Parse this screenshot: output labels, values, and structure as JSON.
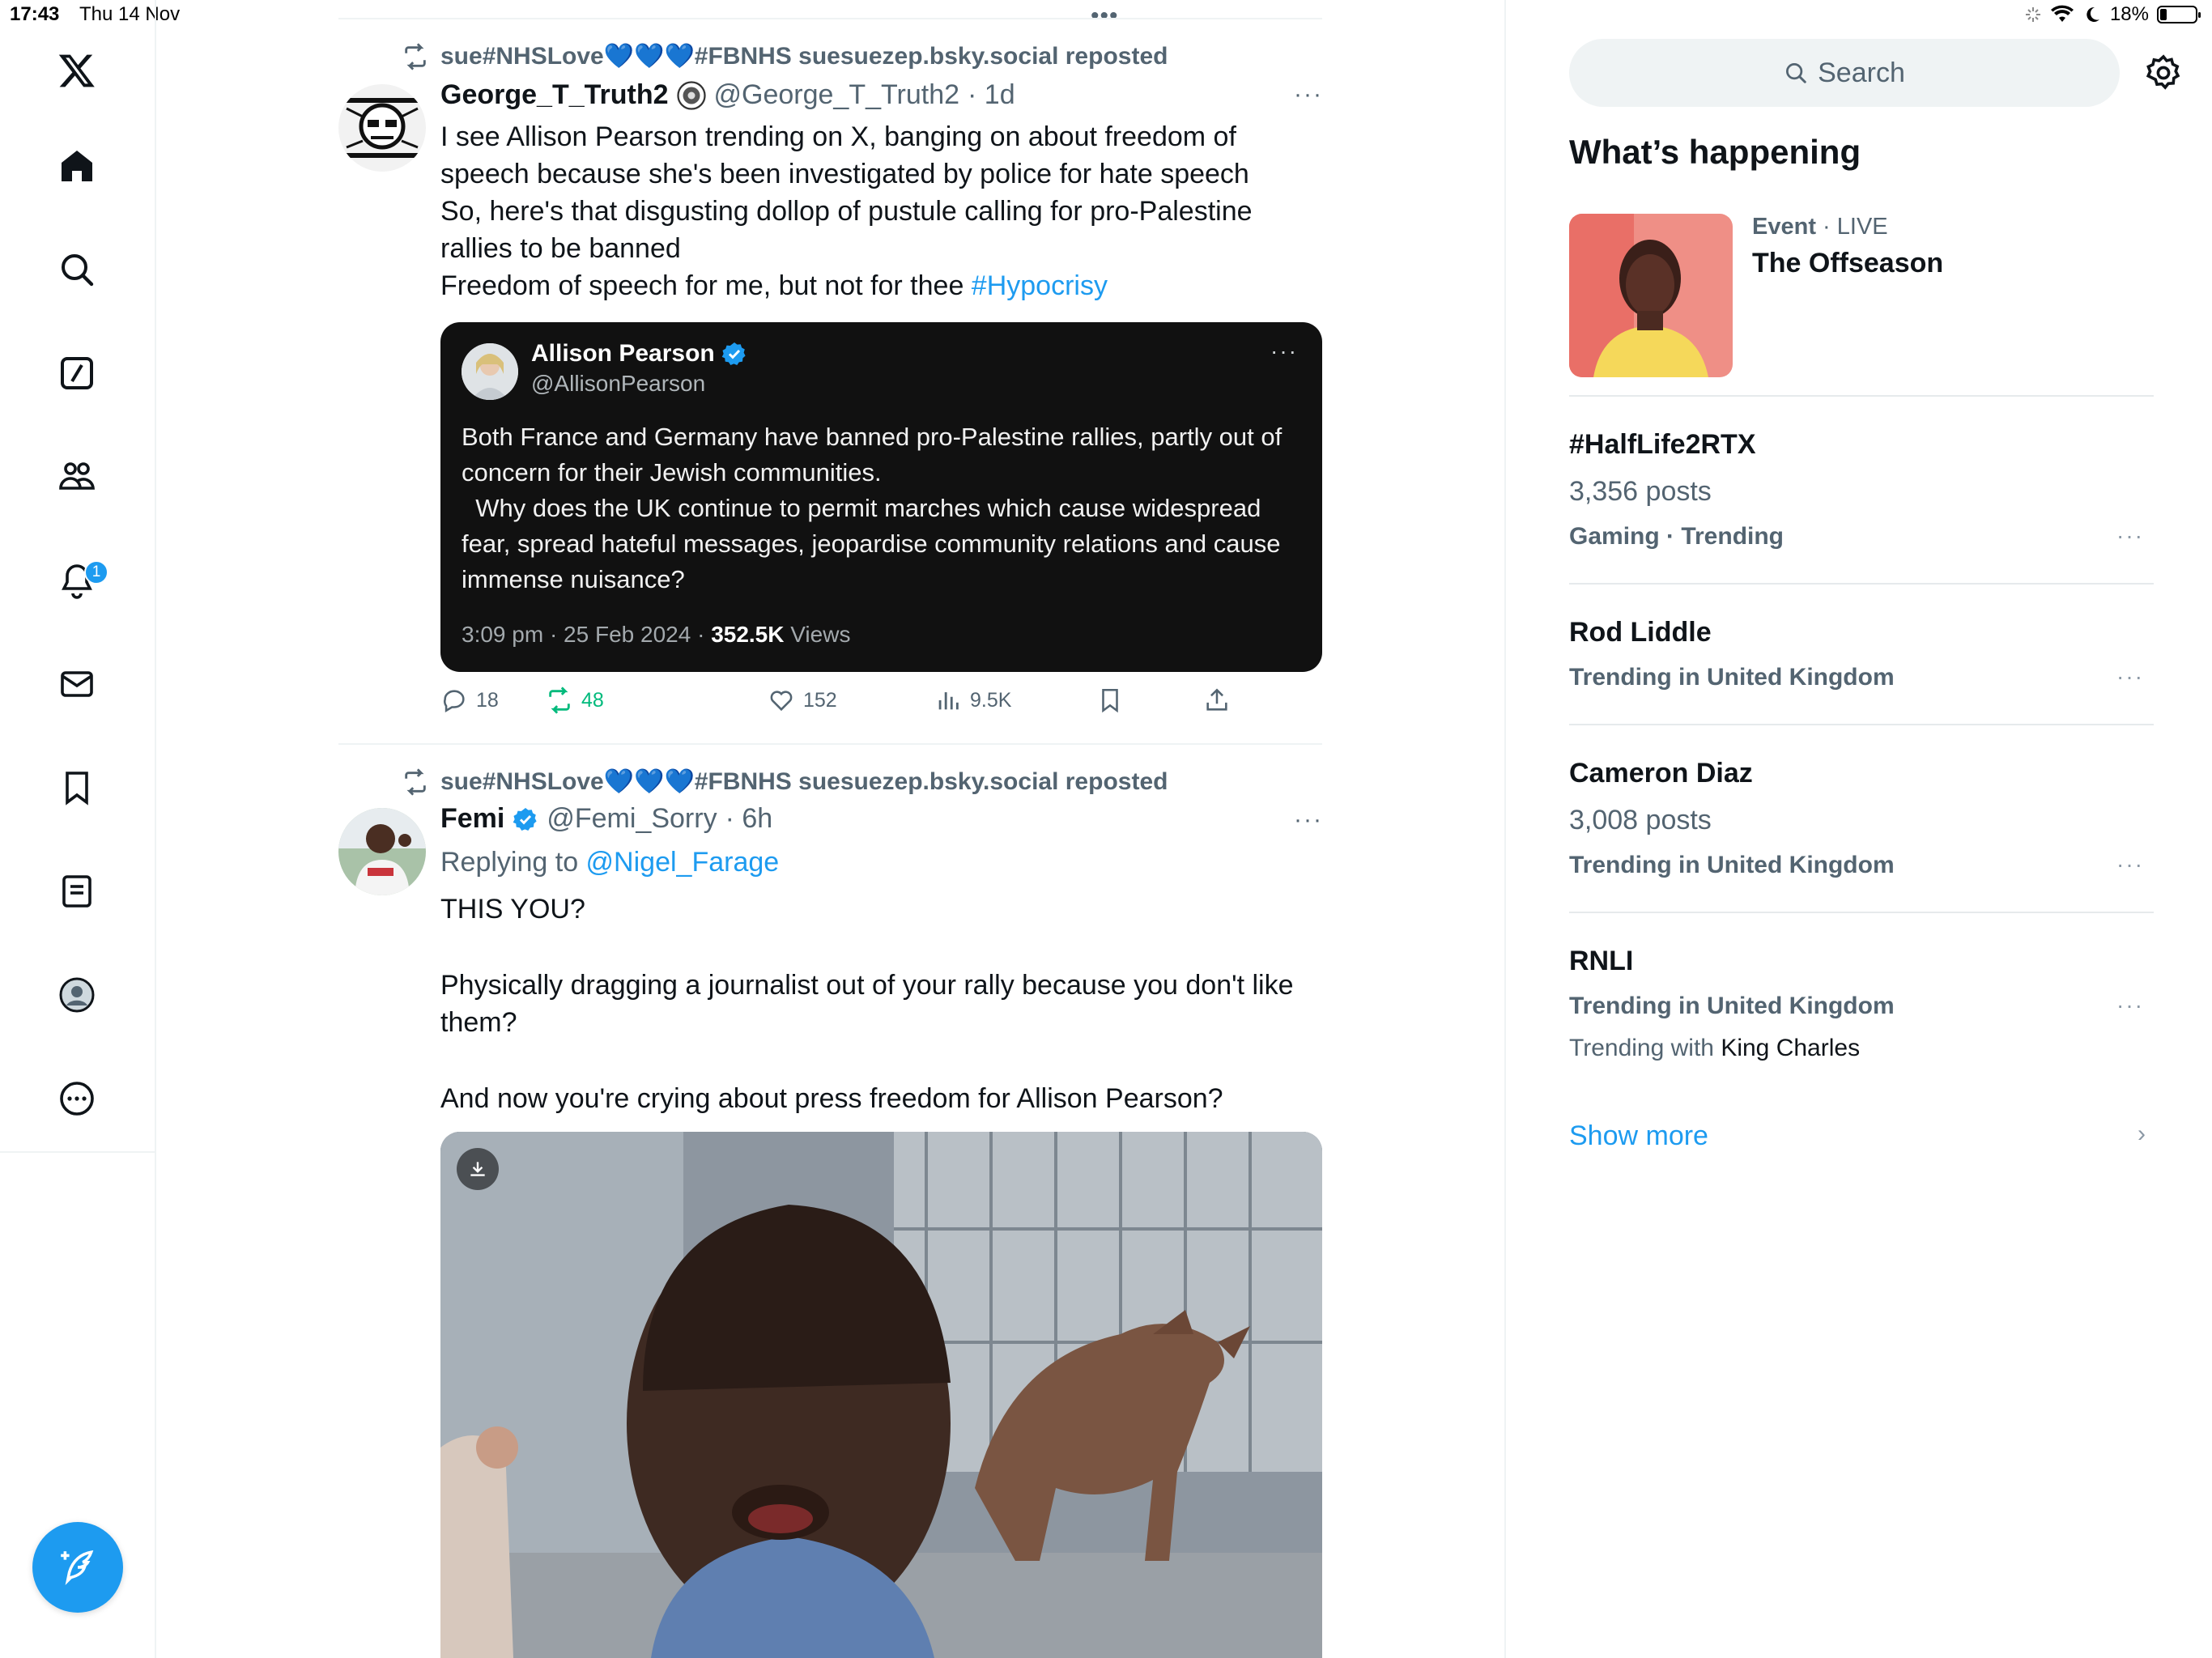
{
  "status_bar": {
    "time": "17:43",
    "date": "Thu 14 Nov",
    "battery": "18%",
    "battery_level": 0.18
  },
  "nav": {
    "items": [
      "x-logo",
      "home",
      "explore",
      "grok",
      "communities",
      "notifications",
      "messages",
      "bookmarks",
      "lists",
      "profile",
      "more"
    ],
    "notification_count": "1"
  },
  "timeline": {
    "top_indicator": "•••",
    "tweets": [
      {
        "repost_label": "sue#NHSLove💙💙💙#FBNHS suesuezep.bsky.social reposted",
        "name": "George_T_Truth2",
        "handle": "@George_T_Truth2",
        "time": "· 1d",
        "text_lines": [
          "I see Allison Pearson trending on X, banging on about freedom of",
          "speech because she's been investigated by police for hate speech",
          "So, here's that disgusting dollop of pustule calling for pro-Palestine",
          "rallies to be banned"
        ],
        "text_last_prefix": "Freedom of speech for me, but not for thee ",
        "text_last_hashtag": "#Hypocrisy",
        "quote": {
          "name": "Allison Pearson",
          "handle": "@AllisonPearson",
          "text": "Both France and Germany have banned pro-Palestine rallies, partly out of concern for their Jewish communities.\n  Why does the UK continue to permit marches which cause widespread fear, spread hateful messages, jeopardise community relations and cause immense nuisance?",
          "time": "3:09 pm · 25 Feb 2024 · ",
          "views_count": "352.5K",
          "views_label": " Views"
        },
        "replies": "18",
        "reposts": "48",
        "likes": "152",
        "views": "9.5K"
      },
      {
        "repost_label": "sue#NHSLove💙💙💙#FBNHS suesuezep.bsky.social reposted",
        "name": "Femi",
        "handle": "@Femi_Sorry",
        "time": "· 6h",
        "replying_prefix": "Replying to ",
        "replying_to": "@Nigel_Farage",
        "text_1": "THIS YOU?",
        "text_2": "Physically dragging a journalist out of your rally because you don't like them?",
        "text_3": "And now you're crying about press freedom for Allison Pearson?"
      }
    ]
  },
  "sidebar": {
    "search_placeholder": "Search",
    "section_title": "What’s happening",
    "event": {
      "category": "Event",
      "live": " · LIVE",
      "title": "The Offseason"
    },
    "trends": [
      {
        "name": "#HalfLife2RTX",
        "posts": "3,356 posts",
        "context": "Gaming · Trending"
      },
      {
        "name": "Rod Liddle",
        "context": "Trending in United Kingdom"
      },
      {
        "name": "Cameron Diaz",
        "posts": "3,008 posts",
        "context": "Trending in United Kingdom"
      },
      {
        "name": "RNLI",
        "context": "Trending in United Kingdom",
        "with_prefix": "Trending with ",
        "with_name": "King Charles"
      }
    ],
    "show_more": "Show more"
  },
  "colors": {
    "accent": "#1d9bf0",
    "retweet_green": "#00ba7c",
    "muted": "#536471"
  }
}
